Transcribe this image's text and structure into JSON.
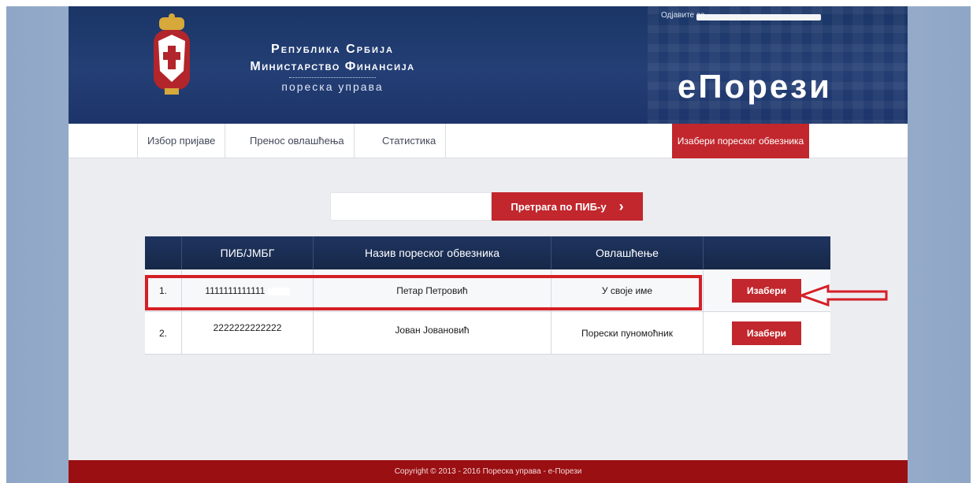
{
  "header": {
    "logo_line1": "Република Србија",
    "logo_line2": "Министарство Финансија",
    "logo_line3": "пореска управа",
    "logout_label": "Одјавите се",
    "app_title": "еПорези"
  },
  "nav": {
    "items": [
      {
        "label": "Избор пријаве"
      },
      {
        "label": "Пренос овлашћења"
      },
      {
        "label": "Статистика"
      }
    ],
    "choose_taxpayer_label": "Изабери пореског обвезника"
  },
  "search": {
    "value": "",
    "button_label": "Претрага по ПИБ-у"
  },
  "table": {
    "columns": [
      "ПИБ/ЈМБГ",
      "Назив пореског обвезника",
      "Овлашћење"
    ],
    "rows": [
      {
        "num": "1.",
        "pib": "1111111111111",
        "name": "Петар Петровић",
        "authorization": "У своје име",
        "action": "Изабери"
      },
      {
        "num": "2.",
        "pib": "2222222222222",
        "name": "Јован Јовановић",
        "authorization": "Порески пуномоћник",
        "action": "Изабери"
      }
    ]
  },
  "footer": {
    "text": "Copyright © 2013 - 2016 Пореска управа - е-Порези"
  },
  "colors": {
    "accent_red": "#c1272d",
    "header_blue": "#1a3566",
    "footer_red": "#9a0f12"
  }
}
